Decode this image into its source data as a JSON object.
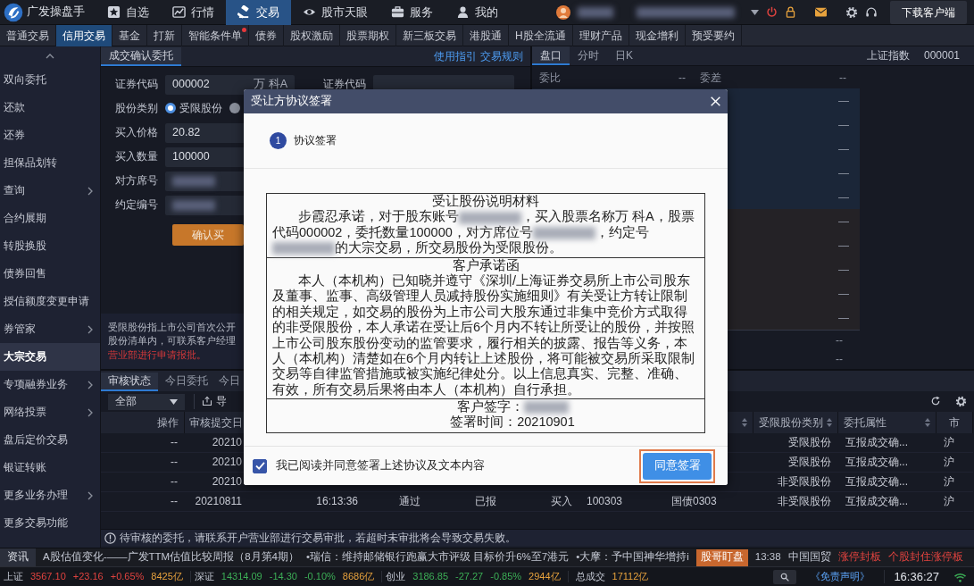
{
  "app": {
    "name": "广发操盘手"
  },
  "nav": [
    {
      "label": "自选",
      "selected": false
    },
    {
      "label": "行情",
      "selected": false
    },
    {
      "label": "交易",
      "selected": true
    },
    {
      "label": "股市天眼",
      "selected": false
    },
    {
      "label": "服务",
      "selected": false
    },
    {
      "label": "我的",
      "selected": false
    }
  ],
  "user": {
    "download_button": "下载客户端"
  },
  "sub_tabs": [
    {
      "label": "普通交易",
      "selected": false,
      "dot": false
    },
    {
      "label": "信用交易",
      "selected": true,
      "dot": false
    },
    {
      "label": "基金",
      "selected": false,
      "dot": false
    },
    {
      "label": "打新",
      "selected": false,
      "dot": false
    },
    {
      "label": "智能条件单",
      "selected": false,
      "dot": true
    },
    {
      "label": "债券",
      "selected": false,
      "dot": false
    },
    {
      "label": "股权激励",
      "selected": false,
      "dot": false
    },
    {
      "label": "股票期权",
      "selected": false,
      "dot": false
    },
    {
      "label": "新三板交易",
      "selected": false,
      "dot": false
    },
    {
      "label": "港股通",
      "selected": false,
      "dot": false
    },
    {
      "label": "H股全流通",
      "selected": false,
      "dot": false
    },
    {
      "label": "理财产品",
      "selected": false,
      "dot": false
    },
    {
      "label": "现金增利",
      "selected": false,
      "dot": false
    },
    {
      "label": "预受要约",
      "selected": false,
      "dot": false
    }
  ],
  "sidebar": {
    "items": [
      {
        "label": "双向委托",
        "selected": false,
        "submenu": false
      },
      {
        "label": "还款",
        "selected": false,
        "submenu": false
      },
      {
        "label": "还券",
        "selected": false,
        "submenu": false
      },
      {
        "label": "担保品划转",
        "selected": false,
        "submenu": false
      },
      {
        "label": "查询",
        "selected": false,
        "submenu": true
      },
      {
        "label": "合约展期",
        "selected": false,
        "submenu": false
      },
      {
        "label": "转股换股",
        "selected": false,
        "submenu": false
      },
      {
        "label": "债券回售",
        "selected": false,
        "submenu": false
      },
      {
        "label": "授信额度变更申请",
        "selected": false,
        "submenu": false
      },
      {
        "label": "券管家",
        "selected": false,
        "submenu": true
      },
      {
        "label": "大宗交易",
        "selected": true,
        "submenu": false
      },
      {
        "label": "专项融券业务",
        "selected": false,
        "submenu": true
      },
      {
        "label": "网络投票",
        "selected": false,
        "submenu": true
      },
      {
        "label": "盘后定价交易",
        "selected": false,
        "submenu": false
      },
      {
        "label": "银证转账",
        "selected": false,
        "submenu": false
      },
      {
        "label": "更多业务办理",
        "selected": false,
        "submenu": true
      },
      {
        "label": "更多交易功能",
        "selected": false,
        "submenu": false
      }
    ]
  },
  "order_panel": {
    "tab": "成交确认委托",
    "links": [
      "使用指引",
      "交易规则"
    ],
    "fields": [
      {
        "kind": "code",
        "label": "证券代码",
        "value": "000002",
        "stock_name": "万 科A",
        "label2": "证券代码"
      },
      {
        "kind": "radio",
        "label": "股份类别",
        "options": [
          {
            "label": "受限股份",
            "selected": true
          },
          {
            "selected": false
          }
        ]
      },
      {
        "kind": "input",
        "label": "买入价格",
        "value": "20.82"
      },
      {
        "kind": "input",
        "label": "买入数量",
        "value": "100000"
      },
      {
        "kind": "redacted",
        "label": "对方席号"
      },
      {
        "kind": "redacted",
        "label": "约定编号"
      }
    ],
    "submit_button": "确认买",
    "note": [
      {
        "text": "受限股份指上市公司首次公开",
        "alert": false
      },
      {
        "text": "股份清单内，可联系客户经理",
        "alert": false
      },
      {
        "text": "营业部进行申请报批。",
        "alert": true
      }
    ]
  },
  "quote_panel": {
    "tabs": [
      {
        "label": "盘口",
        "selected": true
      },
      {
        "label": "分时",
        "selected": false
      },
      {
        "label": "日K",
        "selected": false
      }
    ],
    "index_name": "上证指数",
    "index_code": "000001",
    "summary": [
      {
        "label": "委比",
        "value": "--"
      },
      {
        "label": "委差",
        "value": "--"
      }
    ],
    "levels": [
      "—",
      "—",
      "—",
      "—",
      "—",
      "—",
      "—",
      "—",
      "—",
      "—"
    ],
    "extra": [
      "--",
      "--"
    ]
  },
  "orders": {
    "tabs": [
      {
        "label": "审核状态",
        "selected": true
      },
      {
        "label": "今日委托",
        "selected": false
      },
      {
        "label": "今日",
        "selected": false
      }
    ],
    "filter": "全部",
    "export": "导",
    "columns": [
      {
        "label": "操作",
        "sortable": false
      },
      {
        "label": "审核提交日",
        "sortable": false
      },
      null,
      null,
      null,
      null,
      null,
      {
        "sortable": true
      },
      {
        "label": "受限股份类别",
        "sortable": true
      },
      {
        "label": "委托属性",
        "sortable": true
      },
      {
        "label": "市",
        "sortable": false
      }
    ],
    "rows": [
      [
        "--",
        "20210",
        null,
        null,
        null,
        null,
        null,
        null,
        "受限股份",
        "互报成交确...",
        "沪"
      ],
      [
        "--",
        "20210",
        null,
        null,
        null,
        null,
        null,
        null,
        "受限股份",
        "互报成交确...",
        "沪"
      ],
      [
        "--",
        "20210",
        null,
        null,
        null,
        null,
        null,
        null,
        "非受限股份",
        "互报成交确...",
        "沪"
      ],
      [
        "--",
        "20210811",
        "16:13:36",
        "通过",
        "已报",
        "买入",
        "100303",
        "国债0303",
        "非受限股份",
        "互报成交确...",
        "沪"
      ]
    ],
    "note": "待审核的委托，请联系开户营业部进行交易审批，若超时未审批将会导致交易失败。"
  },
  "dialog": {
    "title": "受让方协议签署",
    "step": {
      "number": "1",
      "label": "协议签署"
    },
    "sections": [
      {
        "title": "受让股份说明材料",
        "segments": [
          {
            "text": "步霞忍承诺，对于股东账号"
          },
          {
            "kind": "redacted"
          },
          {
            "text": "，买入股票名称万 科A，股票代码000002，委托数量100000，对方席位号"
          },
          {
            "kind": "redacted"
          },
          {
            "text": "，约定号"
          },
          {
            "kind": "redacted"
          },
          {
            "text": "的大宗交易，所交易股份为受限股份。"
          }
        ]
      },
      {
        "title": "客户承诺函",
        "segments": [
          {
            "text": "本人（本机构）已知晓并遵守《深圳/上海证券交易所上市公司股东及董事、监事、高级管理人员减持股份实施细则》有关受让方转让限制的相关规定，如交易的股份为上市公司大股东通过非集中竞价方式取得的非受限股份，本人承诺在受让后6个月内不转让所受让的股份，并按照上市公司股东股份变动的监管要求，履行相关的披露、报告等义务，本人（本机构）清楚如在6个月内转让上述股份，将可能被交易所采取限制交易等自律监管措施或被实施纪律处分。以上信息真实、完整、准确、有效，所有交易后果将由本人（本机构）自行承担。"
          }
        ]
      }
    ],
    "signature_label": "客户签字：",
    "sign_time": "签署时间：20210901",
    "agree": {
      "label": "我已阅读并同意签署上述协议及文本内容",
      "checked": true
    },
    "confirm_button": "同意签署",
    "highlighted": true
  },
  "ticker": {
    "tag": "资讯",
    "items": [
      "A股估值变化-——广发TTM估值比较周报（8月第4期）",
      "•瑞信：维持邮储银行跑赢大市评级 目标价升6%至7港元",
      "•大摩：予中国神华增持i"
    ],
    "watch_tag": "股哥盯盘",
    "time": "13:38",
    "stock": "中国国贸",
    "event": "涨停封板",
    "detail": "个股封住涨停板"
  },
  "indices": [
    {
      "name": "上证",
      "price": "3567.10",
      "change": "+23.16",
      "pct": "+0.65%",
      "amount": "8425亿",
      "kind": "up"
    },
    {
      "name": "深证",
      "price": "14314.09",
      "change": "-14.30",
      "pct": "-0.10%",
      "amount": "8686亿",
      "kind": "down"
    },
    {
      "name": "创业",
      "price": "3186.85",
      "change": "-27.27",
      "pct": "-0.85%",
      "amount": "2944亿",
      "kind": "down"
    }
  ],
  "total": {
    "label": "总成交",
    "amount": "17112亿"
  },
  "disclaimer": "《免责声明》",
  "clock": "16:36:27"
}
